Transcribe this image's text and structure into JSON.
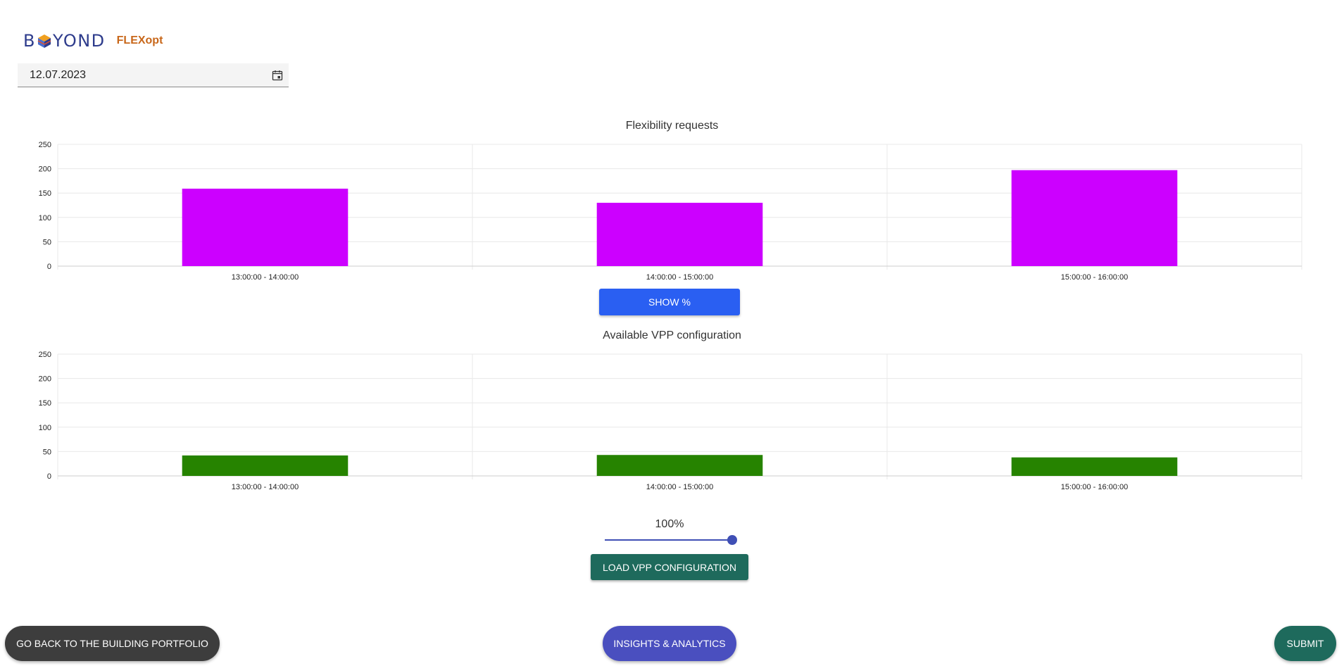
{
  "brand": {
    "name_left": "B",
    "name_right": "YOND",
    "product": "FLEXopt"
  },
  "date_field": {
    "value": "12.07.2023",
    "icon": "calendar-icon"
  },
  "flex_chart_title": "Flexibility requests",
  "vpp_chart_title": "Available VPP configuration",
  "show_button": "SHOW %",
  "slider": {
    "value_label": "100%",
    "value": 1.0
  },
  "load_button": "LOAD VPP CONFIGURATION",
  "footer": {
    "back_button": "GO BACK TO THE BUILDING PORTFOLIO",
    "insights_button": "INSIGHTS & ANALYTICS",
    "submit_button": "SUBMIT"
  },
  "colors": {
    "flex_bar": "#cc00ff",
    "vpp_bar": "#268300",
    "accent_blue": "#2a5ff2",
    "teal": "#1e6a5c"
  },
  "chart_data": [
    {
      "type": "bar",
      "title": "Flexibility requests",
      "categories": [
        "13:00:00 - 14:00:00",
        "14:00:00 - 15:00:00",
        "15:00:00 - 16:00:00"
      ],
      "values": [
        159,
        130,
        197
      ],
      "yticks": [
        0,
        50,
        100,
        150,
        200,
        250
      ],
      "ylim": [
        0,
        250
      ],
      "grid": true
    },
    {
      "type": "bar",
      "title": "Available VPP configuration",
      "categories": [
        "13:00:00 - 14:00:00",
        "14:00:00 - 15:00:00",
        "15:00:00 - 16:00:00"
      ],
      "values": [
        42,
        43,
        38
      ],
      "yticks": [
        0,
        50,
        100,
        150,
        200,
        250
      ],
      "ylim": [
        0,
        250
      ],
      "grid": true
    }
  ]
}
